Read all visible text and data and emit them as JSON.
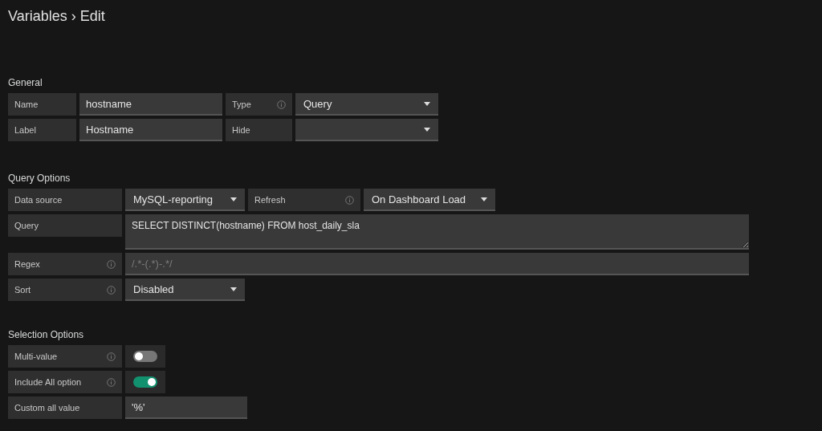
{
  "page_title": "Variables › Edit",
  "sections": [
    {
      "heading": "General",
      "rows": [
        [
          {
            "kind": "label",
            "text": "Name",
            "info": false
          },
          {
            "kind": "input",
            "value": "hostname"
          },
          {
            "kind": "label",
            "text": "Type",
            "info": true
          },
          {
            "kind": "select",
            "value": "Query"
          }
        ],
        [
          {
            "kind": "label",
            "text": "Label",
            "info": false
          },
          {
            "kind": "input",
            "value": "Hostname"
          },
          {
            "kind": "label",
            "text": "Hide",
            "info": false
          },
          {
            "kind": "select"
          }
        ]
      ]
    },
    {
      "heading": "Query Options",
      "rows": [
        [
          {
            "kind": "label",
            "text": "Data source",
            "info": false
          },
          {
            "kind": "select",
            "value": "MySQL-reporting"
          },
          {
            "kind": "label",
            "text": "Refresh",
            "info": true
          },
          {
            "kind": "select",
            "value": "On Dashboard Load"
          }
        ],
        [
          {
            "kind": "label",
            "text": "Query",
            "info": false
          },
          {
            "kind": "textarea",
            "value": "SELECT DISTINCT(hostname) FROM host_daily_sla"
          }
        ],
        [
          {
            "kind": "label",
            "text": "Regex",
            "info": true
          },
          {
            "kind": "input",
            "placeholder": "/.*-(.*)-.*/"
          }
        ],
        [
          {
            "kind": "label",
            "text": "Sort",
            "info": true
          },
          {
            "kind": "select",
            "value": "Disabled"
          }
        ]
      ]
    },
    {
      "heading": "Selection Options",
      "rows": [
        [
          {
            "kind": "label",
            "text": "Multi-value",
            "info": true
          },
          {
            "kind": "switch",
            "on": false
          }
        ],
        [
          {
            "kind": "label",
            "text": "Include All option",
            "info": true
          },
          {
            "kind": "switch",
            "on": true
          }
        ],
        [
          {
            "kind": "label",
            "text": "Custom all value",
            "info": false
          },
          {
            "kind": "input",
            "value": "'%'"
          }
        ]
      ]
    }
  ]
}
